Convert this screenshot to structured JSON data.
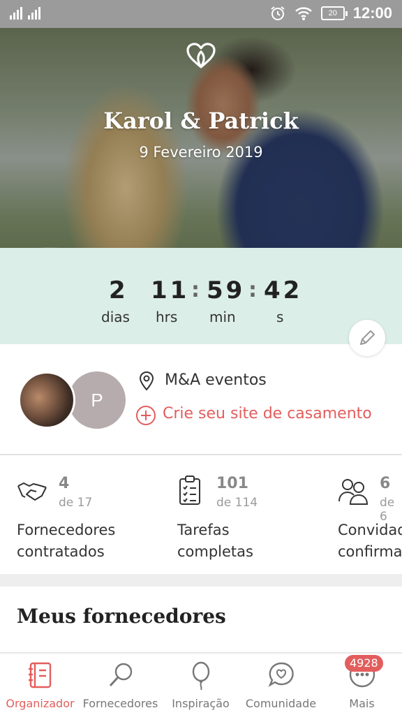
{
  "status_bar": {
    "time": "12:00",
    "battery": "20"
  },
  "hero": {
    "couple_names": "Karol & Patrick",
    "wedding_date": "9 Fevereiro 2019"
  },
  "countdown": {
    "days": "2",
    "days_label": "dias",
    "hours": "11",
    "hours_label": "hrs",
    "minutes": "59",
    "minutes_label": "min",
    "seconds": "42",
    "seconds_label": "s",
    "separator": ":"
  },
  "profile": {
    "avatar_initial": "P",
    "vendor_name": "M&A eventos",
    "create_site_link": "Crie seu site de casamento"
  },
  "stats": [
    {
      "value": "4",
      "of": "de 17",
      "label_line1": "Fornecedores",
      "label_line2": "contratados"
    },
    {
      "value": "101",
      "of": "de 114",
      "label_line1": "Tarefas",
      "label_line2": "completas"
    },
    {
      "value": "6",
      "of": "de 6",
      "label_line1": "Convidados",
      "label_line2": "confirmados"
    }
  ],
  "section": {
    "title": "Meus fornecedores"
  },
  "bottom_nav": {
    "items": [
      {
        "label": "Organizador",
        "active": true
      },
      {
        "label": "Fornecedores"
      },
      {
        "label": "Inspiração"
      },
      {
        "label": "Comunidade"
      },
      {
        "label": "Mais"
      }
    ],
    "badge": "4928"
  },
  "colors": {
    "accent": "#e35d5d",
    "countdown_bg": "#dceee8",
    "status_bar": "#9b9b9b"
  }
}
